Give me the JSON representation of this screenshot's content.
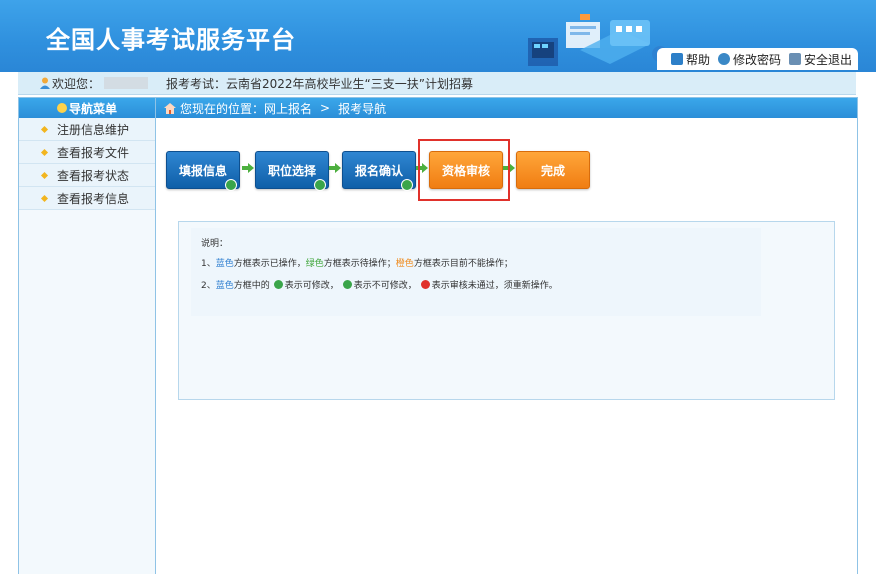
{
  "header": {
    "title": "全国人事考试服务平台",
    "links": [
      {
        "label": "帮助",
        "icon": "help-icon",
        "color": "#2d7fc8"
      },
      {
        "label": "修改密码",
        "icon": "edit-password-icon",
        "color": "#3a88c6"
      },
      {
        "label": "安全退出",
        "icon": "logout-icon",
        "color": "#6a8fb3"
      }
    ]
  },
  "welcome": {
    "greeting": "欢迎您：",
    "exam_label": "报考考试：云南省2022年高校毕业生“三支一扶”计划招募"
  },
  "sidebar": {
    "title": "导航菜单",
    "items": [
      {
        "label": "注册信息维护"
      },
      {
        "label": "查看报考文件"
      },
      {
        "label": "查看报考状态"
      },
      {
        "label": "查看报考信息"
      }
    ]
  },
  "breadcrumb": {
    "prefix": "您现在的位置：",
    "level1": "网上报名",
    "separator": ">",
    "level2": "报考导航"
  },
  "steps": [
    {
      "label": "填报信息",
      "state": "completed",
      "badge": "not-modifiable"
    },
    {
      "label": "职位选择",
      "state": "completed",
      "badge": "not-modifiable"
    },
    {
      "label": "报名确认",
      "state": "completed",
      "badge": "modifiable"
    },
    {
      "label": "资格审核",
      "state": "unavailable",
      "badge": ""
    },
    {
      "label": "完成",
      "state": "unavailable",
      "badge": ""
    }
  ],
  "notes": {
    "heading": "说明：",
    "line1": {
      "prefix": "1、",
      "blue": "蓝色",
      "t1": "方框表示已操作，",
      "green": "绿色",
      "t2": "方框表示待操作；",
      "orange": "橙色",
      "t3": "方框表示目前不能操作；"
    },
    "line2": {
      "prefix": "2、",
      "blue": "蓝色",
      "t1": "方框中的",
      "t2": "表示可修改，",
      "t3": "表示不可修改，",
      "t4": "表示审核未通过，须重新操作。"
    }
  },
  "colors": {
    "header_blue": "#2f90de",
    "step_blue": "#0f5fa8",
    "step_orange": "#f07d12",
    "badge_green": "#3aa54a",
    "badge_red": "#e0312b",
    "highlight_red": "#e0312b"
  }
}
